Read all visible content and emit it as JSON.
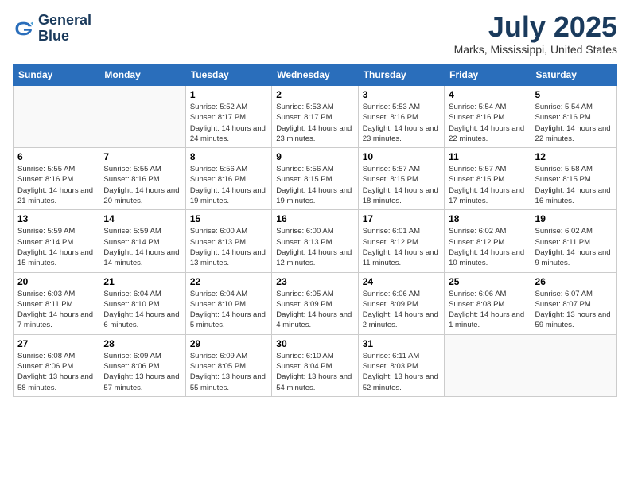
{
  "header": {
    "logo_line1": "General",
    "logo_line2": "Blue",
    "month_year": "July 2025",
    "location": "Marks, Mississippi, United States"
  },
  "weekdays": [
    "Sunday",
    "Monday",
    "Tuesday",
    "Wednesday",
    "Thursday",
    "Friday",
    "Saturday"
  ],
  "weeks": [
    [
      {
        "day": "",
        "info": ""
      },
      {
        "day": "",
        "info": ""
      },
      {
        "day": "1",
        "info": "Sunrise: 5:52 AM\nSunset: 8:17 PM\nDaylight: 14 hours and 24 minutes."
      },
      {
        "day": "2",
        "info": "Sunrise: 5:53 AM\nSunset: 8:17 PM\nDaylight: 14 hours and 23 minutes."
      },
      {
        "day": "3",
        "info": "Sunrise: 5:53 AM\nSunset: 8:16 PM\nDaylight: 14 hours and 23 minutes."
      },
      {
        "day": "4",
        "info": "Sunrise: 5:54 AM\nSunset: 8:16 PM\nDaylight: 14 hours and 22 minutes."
      },
      {
        "day": "5",
        "info": "Sunrise: 5:54 AM\nSunset: 8:16 PM\nDaylight: 14 hours and 22 minutes."
      }
    ],
    [
      {
        "day": "6",
        "info": "Sunrise: 5:55 AM\nSunset: 8:16 PM\nDaylight: 14 hours and 21 minutes."
      },
      {
        "day": "7",
        "info": "Sunrise: 5:55 AM\nSunset: 8:16 PM\nDaylight: 14 hours and 20 minutes."
      },
      {
        "day": "8",
        "info": "Sunrise: 5:56 AM\nSunset: 8:16 PM\nDaylight: 14 hours and 19 minutes."
      },
      {
        "day": "9",
        "info": "Sunrise: 5:56 AM\nSunset: 8:15 PM\nDaylight: 14 hours and 19 minutes."
      },
      {
        "day": "10",
        "info": "Sunrise: 5:57 AM\nSunset: 8:15 PM\nDaylight: 14 hours and 18 minutes."
      },
      {
        "day": "11",
        "info": "Sunrise: 5:57 AM\nSunset: 8:15 PM\nDaylight: 14 hours and 17 minutes."
      },
      {
        "day": "12",
        "info": "Sunrise: 5:58 AM\nSunset: 8:15 PM\nDaylight: 14 hours and 16 minutes."
      }
    ],
    [
      {
        "day": "13",
        "info": "Sunrise: 5:59 AM\nSunset: 8:14 PM\nDaylight: 14 hours and 15 minutes."
      },
      {
        "day": "14",
        "info": "Sunrise: 5:59 AM\nSunset: 8:14 PM\nDaylight: 14 hours and 14 minutes."
      },
      {
        "day": "15",
        "info": "Sunrise: 6:00 AM\nSunset: 8:13 PM\nDaylight: 14 hours and 13 minutes."
      },
      {
        "day": "16",
        "info": "Sunrise: 6:00 AM\nSunset: 8:13 PM\nDaylight: 14 hours and 12 minutes."
      },
      {
        "day": "17",
        "info": "Sunrise: 6:01 AM\nSunset: 8:12 PM\nDaylight: 14 hours and 11 minutes."
      },
      {
        "day": "18",
        "info": "Sunrise: 6:02 AM\nSunset: 8:12 PM\nDaylight: 14 hours and 10 minutes."
      },
      {
        "day": "19",
        "info": "Sunrise: 6:02 AM\nSunset: 8:11 PM\nDaylight: 14 hours and 9 minutes."
      }
    ],
    [
      {
        "day": "20",
        "info": "Sunrise: 6:03 AM\nSunset: 8:11 PM\nDaylight: 14 hours and 7 minutes."
      },
      {
        "day": "21",
        "info": "Sunrise: 6:04 AM\nSunset: 8:10 PM\nDaylight: 14 hours and 6 minutes."
      },
      {
        "day": "22",
        "info": "Sunrise: 6:04 AM\nSunset: 8:10 PM\nDaylight: 14 hours and 5 minutes."
      },
      {
        "day": "23",
        "info": "Sunrise: 6:05 AM\nSunset: 8:09 PM\nDaylight: 14 hours and 4 minutes."
      },
      {
        "day": "24",
        "info": "Sunrise: 6:06 AM\nSunset: 8:09 PM\nDaylight: 14 hours and 2 minutes."
      },
      {
        "day": "25",
        "info": "Sunrise: 6:06 AM\nSunset: 8:08 PM\nDaylight: 14 hours and 1 minute."
      },
      {
        "day": "26",
        "info": "Sunrise: 6:07 AM\nSunset: 8:07 PM\nDaylight: 13 hours and 59 minutes."
      }
    ],
    [
      {
        "day": "27",
        "info": "Sunrise: 6:08 AM\nSunset: 8:06 PM\nDaylight: 13 hours and 58 minutes."
      },
      {
        "day": "28",
        "info": "Sunrise: 6:09 AM\nSunset: 8:06 PM\nDaylight: 13 hours and 57 minutes."
      },
      {
        "day": "29",
        "info": "Sunrise: 6:09 AM\nSunset: 8:05 PM\nDaylight: 13 hours and 55 minutes."
      },
      {
        "day": "30",
        "info": "Sunrise: 6:10 AM\nSunset: 8:04 PM\nDaylight: 13 hours and 54 minutes."
      },
      {
        "day": "31",
        "info": "Sunrise: 6:11 AM\nSunset: 8:03 PM\nDaylight: 13 hours and 52 minutes."
      },
      {
        "day": "",
        "info": ""
      },
      {
        "day": "",
        "info": ""
      }
    ]
  ]
}
